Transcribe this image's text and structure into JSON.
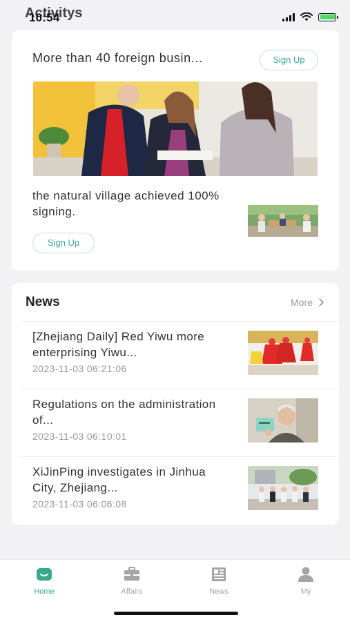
{
  "status_bar": {
    "time": "10:54",
    "page_heading": "Activitys"
  },
  "activities": {
    "item1": {
      "title": "More than 40 foreign busin...",
      "sign_up_label": "Sign Up"
    },
    "item2": {
      "text": "the natural village achieved 100% signing.",
      "sign_up_label": "Sign Up"
    }
  },
  "news": {
    "title": "News",
    "more_label": "More",
    "items": [
      {
        "title": "[Zhejiang Daily] Red Yiwu more enterprising Yiwu...",
        "date": "2023-11-03 06:21:06"
      },
      {
        "title": "Regulations on the administration of...",
        "date": "2023-11-03 06:10:01"
      },
      {
        "title": "XiJinPing investigates in Jinhua City, Zhejiang...",
        "date": "2023-11-03 06:06:08"
      }
    ]
  },
  "tab_bar": {
    "tabs": [
      {
        "label": "Home",
        "icon": "home-icon",
        "active": true
      },
      {
        "label": "Affairs",
        "icon": "briefcase-icon",
        "active": false
      },
      {
        "label": "News",
        "icon": "newspaper-icon",
        "active": false
      },
      {
        "label": "My",
        "icon": "person-icon",
        "active": false
      }
    ]
  },
  "colors": {
    "accent": "#3aa88f",
    "background": "#f2f2f5",
    "inactive": "#a5a5a5"
  }
}
